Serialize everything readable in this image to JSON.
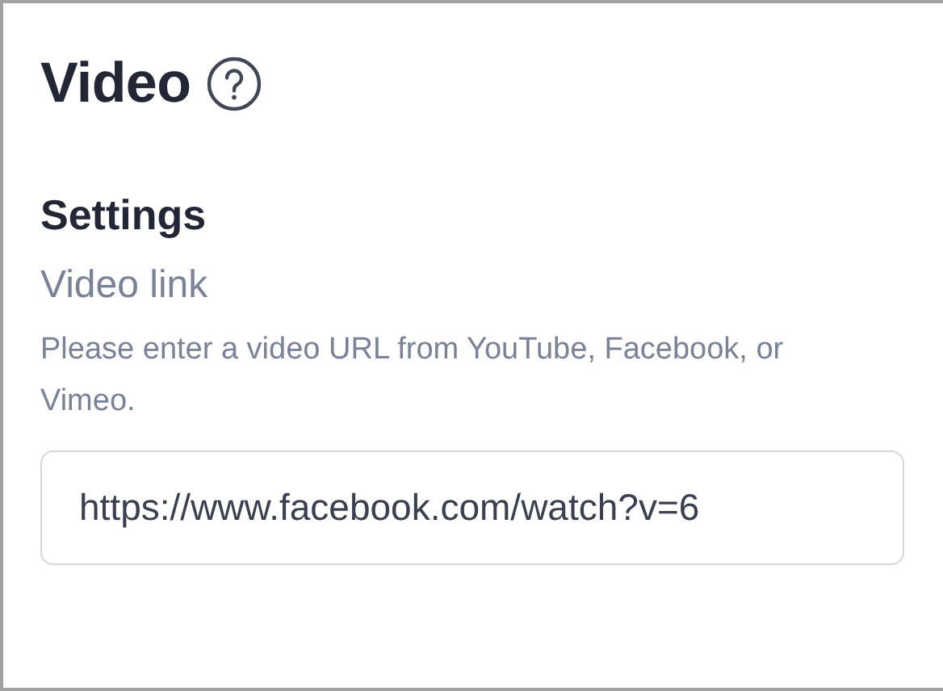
{
  "panel": {
    "title": "Video"
  },
  "section": {
    "heading": "Settings"
  },
  "field": {
    "label": "Video link",
    "help": "Please enter a video URL from YouTube, Facebook, or Vimeo.",
    "value": "https://www.facebook.com/watch?v=6"
  }
}
